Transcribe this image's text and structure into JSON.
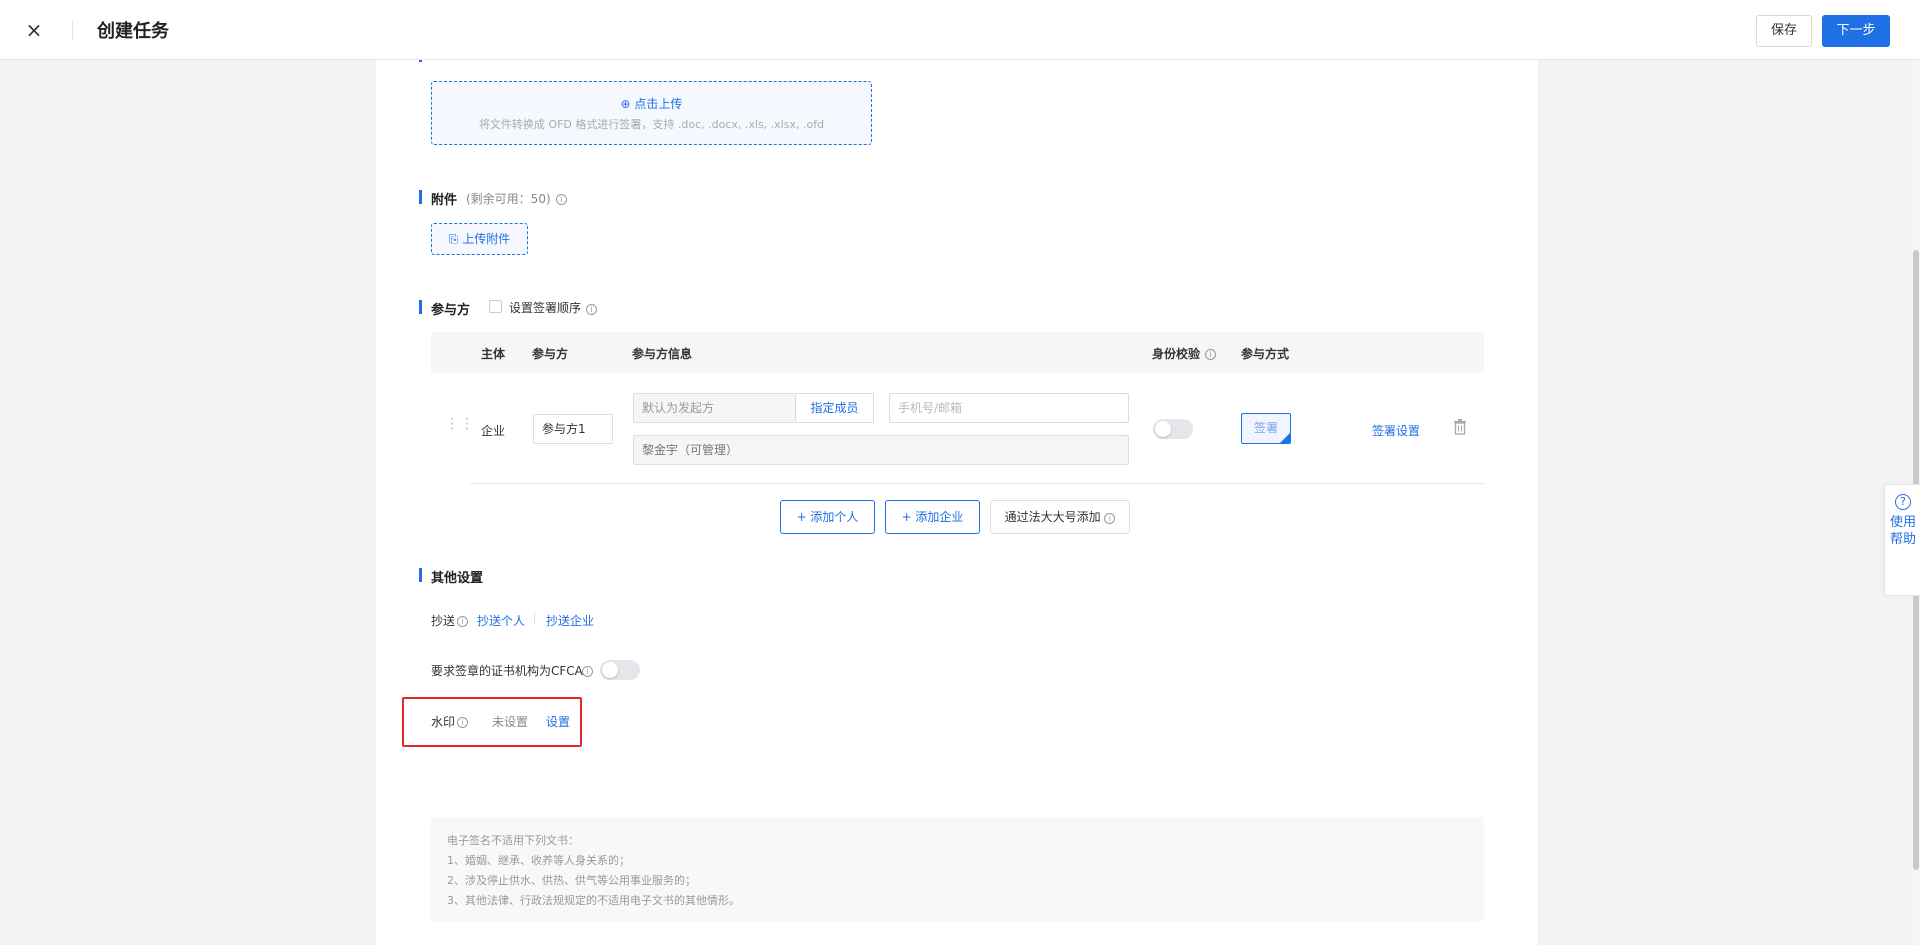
{
  "header": {
    "close_icon": "×",
    "title": "创建任务",
    "save_label": "保存",
    "next_label": "下一步"
  },
  "upload": {
    "link_label": "点击上传",
    "hint": "将文件转换成 OFD 格式进行签署，支持 .doc, .docx, .xls, .xlsx, .ofd"
  },
  "attachments": {
    "title": "附件",
    "remaining": "(剩余可用：50)",
    "upload_label": "上传附件"
  },
  "participants": {
    "title": "参与方",
    "order_checkbox_label": "设置签署顺序",
    "columns": [
      "主体",
      "参与方",
      "参与方信息",
      "身份校验",
      "参与方式"
    ],
    "row": {
      "subject": "企业",
      "name": "参与方1",
      "initiator_placeholder": "默认为发起方",
      "assign_member": "指定成员",
      "contact_placeholder": "手机号/邮箱",
      "member": "黎金宇（可管理）",
      "sign_method": "签署",
      "sign_settings": "签署设置"
    },
    "add_person": "+ 添加个人",
    "add_company": "+ 添加企业",
    "add_via_legal": "通过法大大号添加"
  },
  "other": {
    "title": "其他设置",
    "cc_label": "抄送",
    "cc_person": "抄送个人",
    "cc_company": "抄送企业",
    "cfca_label": "要求签章的证书机构为CFCA",
    "watermark_label": "水印",
    "watermark_status": "未设置",
    "watermark_set": "设置"
  },
  "notice": {
    "lines": [
      "电子签名不适用下列文书：",
      "1、婚姻、继承、收养等人身关系的；",
      "2、涉及停止供水、供热、供气等公用事业服务的；",
      "3、其他法律、行政法规规定的不适用电子文书的其他情形。"
    ]
  },
  "help": {
    "icon": "?",
    "label": "使用帮助"
  },
  "colors": {
    "accent": "#1f6fe5",
    "highlight_border": "#e5262b"
  }
}
